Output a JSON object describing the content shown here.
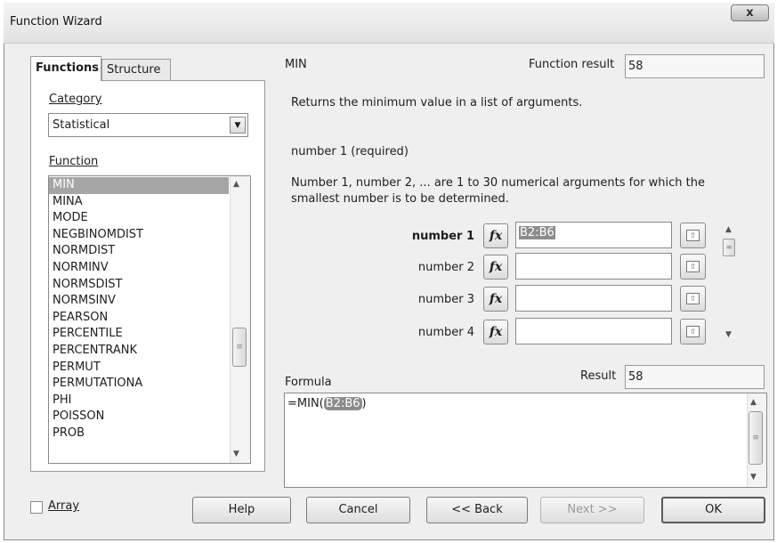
{
  "window": {
    "title": "Function Wizard",
    "close_glyph": "x"
  },
  "tabs": [
    {
      "label": "Functions"
    },
    {
      "label": "Structure"
    }
  ],
  "category": {
    "label": "Category",
    "value": "Statistical"
  },
  "function_list": {
    "label": "Function",
    "items": [
      "MIN",
      "MINA",
      "MODE",
      "NEGBINOMDIST",
      "NORMDIST",
      "NORMINV",
      "NORMSDIST",
      "NORMSINV",
      "PEARSON",
      "PERCENTILE",
      "PERCENTRANK",
      "PERMUT",
      "PERMUTATIONA",
      "PHI",
      "POISSON",
      "PROB"
    ],
    "selected": "MIN"
  },
  "function_info": {
    "name": "MIN",
    "result_label": "Function result",
    "result_value": "58",
    "description": "Returns the minimum value in a list of arguments.",
    "arg_heading": "number 1 (required)",
    "arg_description": "Number 1, number 2, ... are 1 to 30 numerical arguments for which the smallest number is to be determined."
  },
  "arguments": [
    {
      "label": "number 1",
      "value": "B2:B6"
    },
    {
      "label": "number 2",
      "value": ""
    },
    {
      "label": "number 3",
      "value": ""
    },
    {
      "label": "number 4",
      "value": ""
    }
  ],
  "fx_glyph": "fx",
  "formula": {
    "label": "Formula",
    "prefix": "=MIN(",
    "selected": "B2:B6",
    "suffix": ")"
  },
  "result": {
    "label": "Result",
    "value": "58"
  },
  "buttons": {
    "array": "Array",
    "help": "Help",
    "cancel": "Cancel",
    "back": "<< Back",
    "next": "Next >>",
    "ok": "OK"
  }
}
